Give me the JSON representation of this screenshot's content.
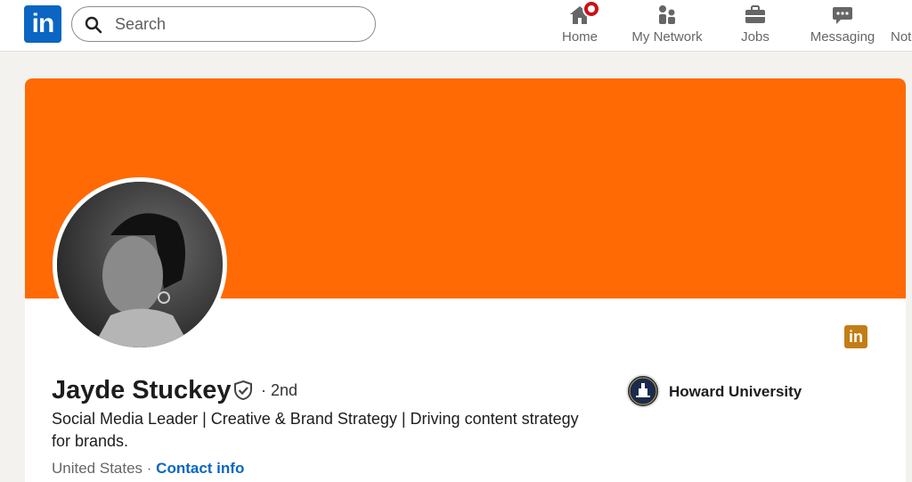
{
  "nav": {
    "logo_text": "in",
    "search_placeholder": "Search",
    "items": [
      {
        "label": "Home",
        "icon": "home-icon"
      },
      {
        "label": "My Network",
        "icon": "network-icon"
      },
      {
        "label": "Jobs",
        "icon": "briefcase-icon"
      },
      {
        "label": "Messaging",
        "icon": "message-icon"
      },
      {
        "label": "Not",
        "icon": "bell-icon"
      }
    ]
  },
  "profile": {
    "name": "Jayde Stuckey",
    "degree": "· 2nd",
    "headline": "Social Media Leader | Creative & Brand Strategy | Driving content strategy for brands.",
    "location": "United States",
    "separator": " · ",
    "contact_label": "Contact info",
    "education": "Howard University",
    "badge_text": "in",
    "banner_color": "#ff6a05"
  },
  "colors": {
    "brand": "#0a66c2",
    "badge": "#c37d16",
    "notification": "#cc1016"
  }
}
